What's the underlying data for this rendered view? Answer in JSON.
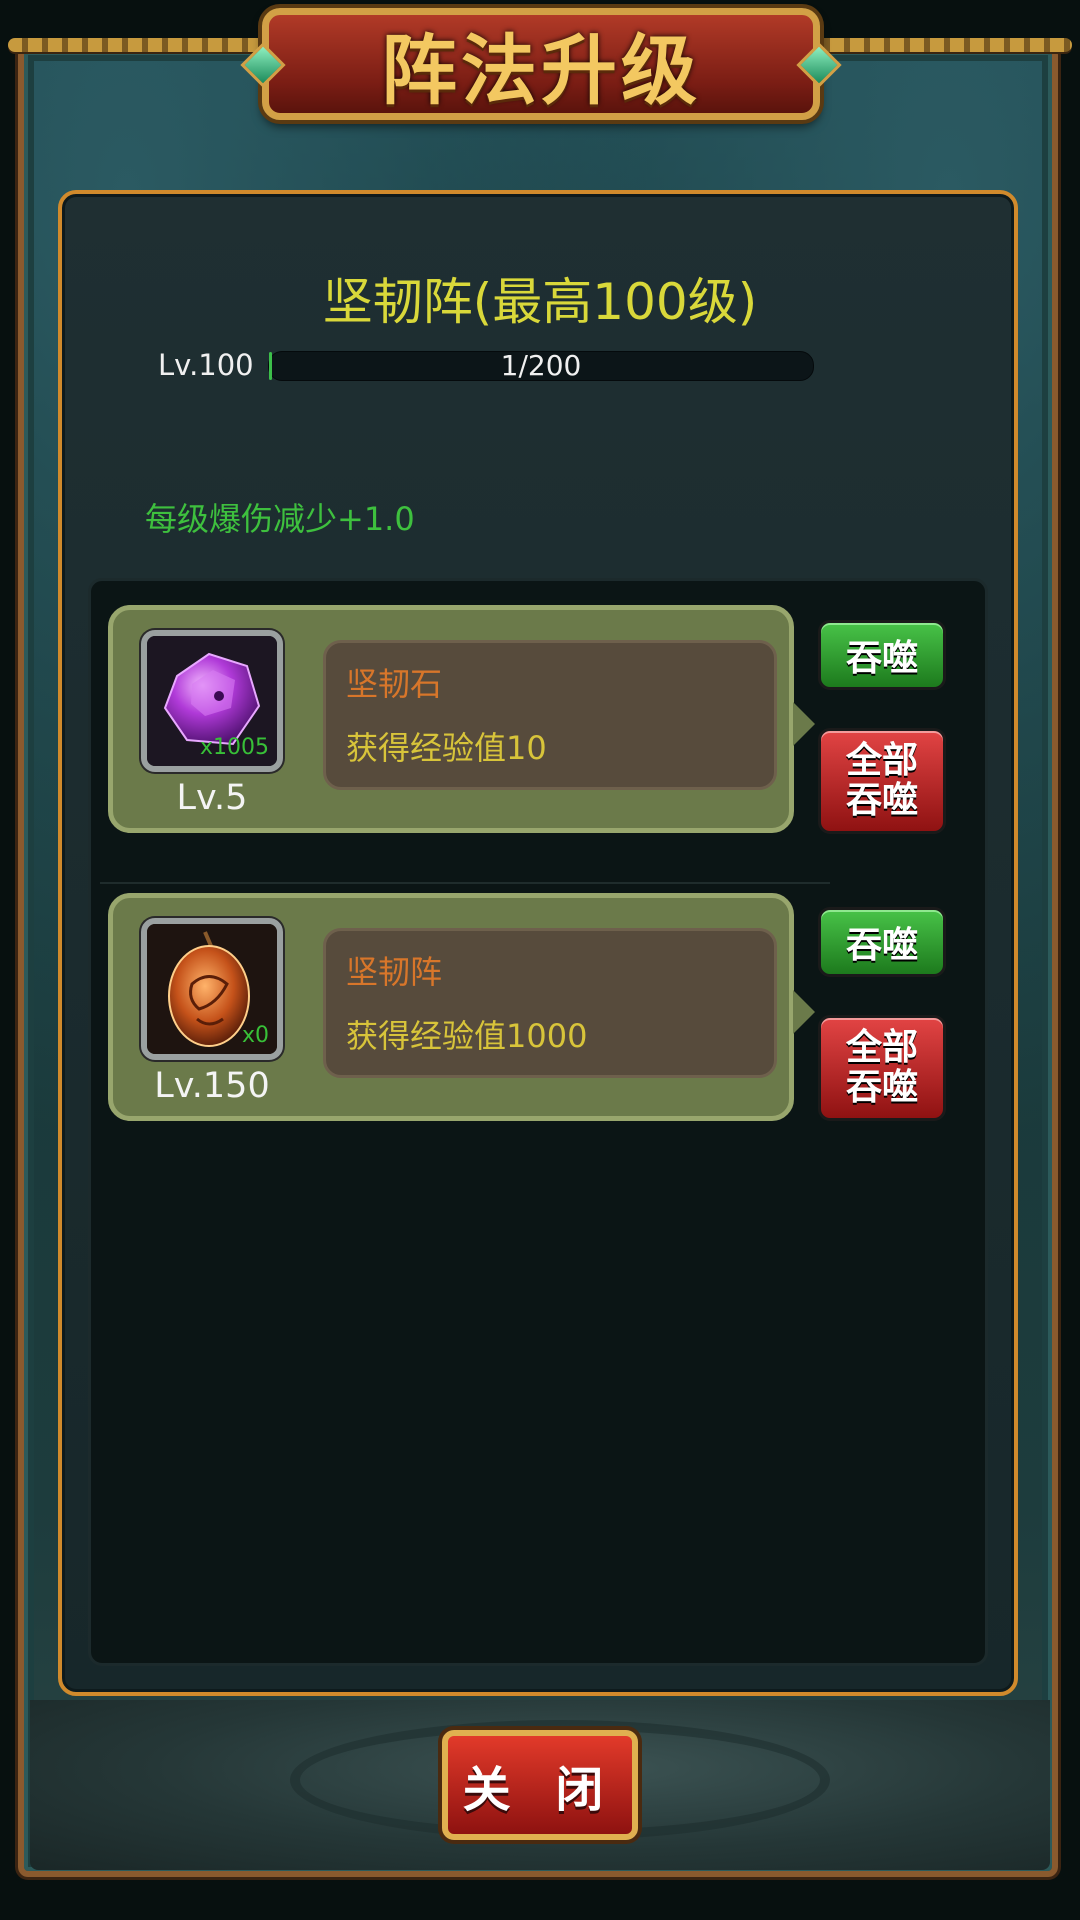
{
  "window": {
    "title": "阵法升级",
    "close_label": "关 闭"
  },
  "formation": {
    "title": "坚韧阵(最高100级)",
    "level_label": "Lv.100",
    "progress_text": "1/200",
    "progress_fraction": 0.005,
    "bonus_text": "每级爆伤减少+1.0"
  },
  "items": [
    {
      "name": "坚韧石",
      "exp_text": "获得经验值10",
      "count": "x1005",
      "level": "Lv.5",
      "icon": "purple-gem-icon",
      "devour_label": "吞噬",
      "devour_all_line1": "全部",
      "devour_all_line2": "吞噬"
    },
    {
      "name": "坚韧阵",
      "exp_text": "获得经验值1000",
      "count": "x0",
      "level": "Lv.150",
      "icon": "formation-stone-icon",
      "devour_label": "吞噬",
      "devour_all_line1": "全部",
      "devour_all_line2": "吞噬"
    }
  ],
  "colors": {
    "title_yellow": "#d9d83a",
    "bonus_green": "#3ec03e",
    "item_name_orange": "#d8762a",
    "exp_yellow": "#d8c43a",
    "panel_border": "#d08a2c"
  }
}
